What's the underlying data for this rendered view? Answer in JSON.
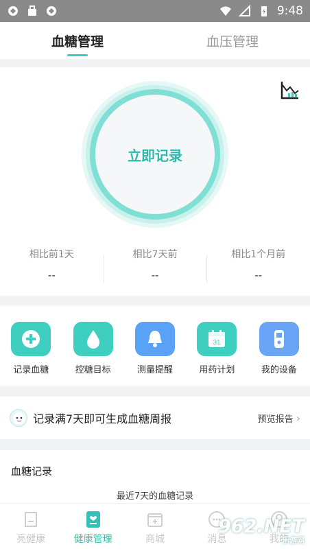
{
  "status_bar": {
    "time": "9:48"
  },
  "tabs": [
    {
      "label": "血糖管理",
      "active": true
    },
    {
      "label": "血压管理",
      "active": false
    }
  ],
  "main": {
    "record_button": "立即记录",
    "compare": [
      {
        "label": "相比前1天",
        "value": "--"
      },
      {
        "label": "相比7天前",
        "value": "--"
      },
      {
        "label": "相比1个月前",
        "value": "--"
      }
    ]
  },
  "tools": [
    {
      "label": "记录血糖",
      "icon": "plus-circle-icon",
      "color": "#3ecfc0"
    },
    {
      "label": "控糖目标",
      "icon": "drop-icon",
      "color": "#3ecfc0"
    },
    {
      "label": "测量提醒",
      "icon": "bell-icon",
      "color": "#5aa2f5"
    },
    {
      "label": "用药计划",
      "icon": "calendar-icon",
      "color": "#3ecfc0"
    },
    {
      "label": "我的设备",
      "icon": "meter-device-icon",
      "color": "#6aa4f7"
    }
  ],
  "report": {
    "text": "记录满7天即可生成血糖周报",
    "link": "预览报告"
  },
  "records": {
    "title": "血糖记录",
    "subtitle": "最近7天的血糖记录"
  },
  "bottom_nav": [
    {
      "label": "亮健康",
      "active": false
    },
    {
      "label": "健康管理",
      "active": true
    },
    {
      "label": "商城",
      "active": false
    },
    {
      "label": "消息",
      "active": false
    },
    {
      "label": "我的",
      "active": false
    }
  ],
  "watermark": {
    "main": "962.NET",
    "sub": "乐游网"
  },
  "colors": {
    "accent": "#3bcbbd",
    "status_bar": "#8a8a8a"
  }
}
